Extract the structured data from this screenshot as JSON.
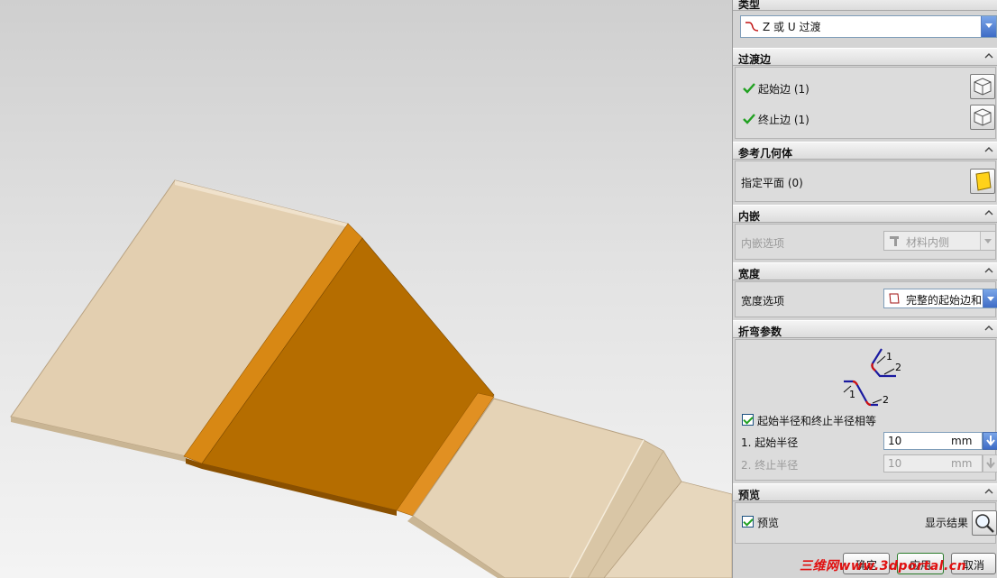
{
  "panel": {
    "type_section": {
      "title": "类型",
      "type_value": "Z 或 U 过渡"
    },
    "transition_edges": {
      "title": "过渡边",
      "start_edge_label": "起始边 (1)",
      "end_edge_label": "终止边 (1)"
    },
    "reference_geometry": {
      "title": "参考几何体",
      "plane_label": "指定平面 (0)"
    },
    "inset": {
      "title": "内嵌",
      "option_label": "内嵌选项",
      "option_value": "材料内侧"
    },
    "width": {
      "title": "宽度",
      "option_label": "宽度选项",
      "option_value": "完整的起始边和"
    },
    "bend_params": {
      "title": "折弯参数",
      "equal_radii_label": "起始半径和终止半径相等",
      "equal_radii_checked": true,
      "diagram_labels": [
        "1",
        "2",
        "1",
        "2"
      ],
      "start_radius_label": "1. 起始半径",
      "start_radius_value": "10",
      "start_radius_unit": "mm",
      "end_radius_label": "2. 终止半径",
      "end_radius_value": "10",
      "end_radius_unit": "mm"
    },
    "preview": {
      "title": "预览",
      "preview_label": "预览",
      "preview_checked": true,
      "show_result_label": "显示结果"
    },
    "buttons": {
      "ok": "确定",
      "apply": "应用",
      "cancel": "取消"
    }
  },
  "watermark": "三维网www.3dportal.cn",
  "colors": {
    "flange_light": "#e3cfb0",
    "flange_dark": "#b56d00",
    "bend_orange": "#d88814",
    "panel_bg": "#d4d4d4",
    "accent_blue": "#3e6cc6"
  }
}
